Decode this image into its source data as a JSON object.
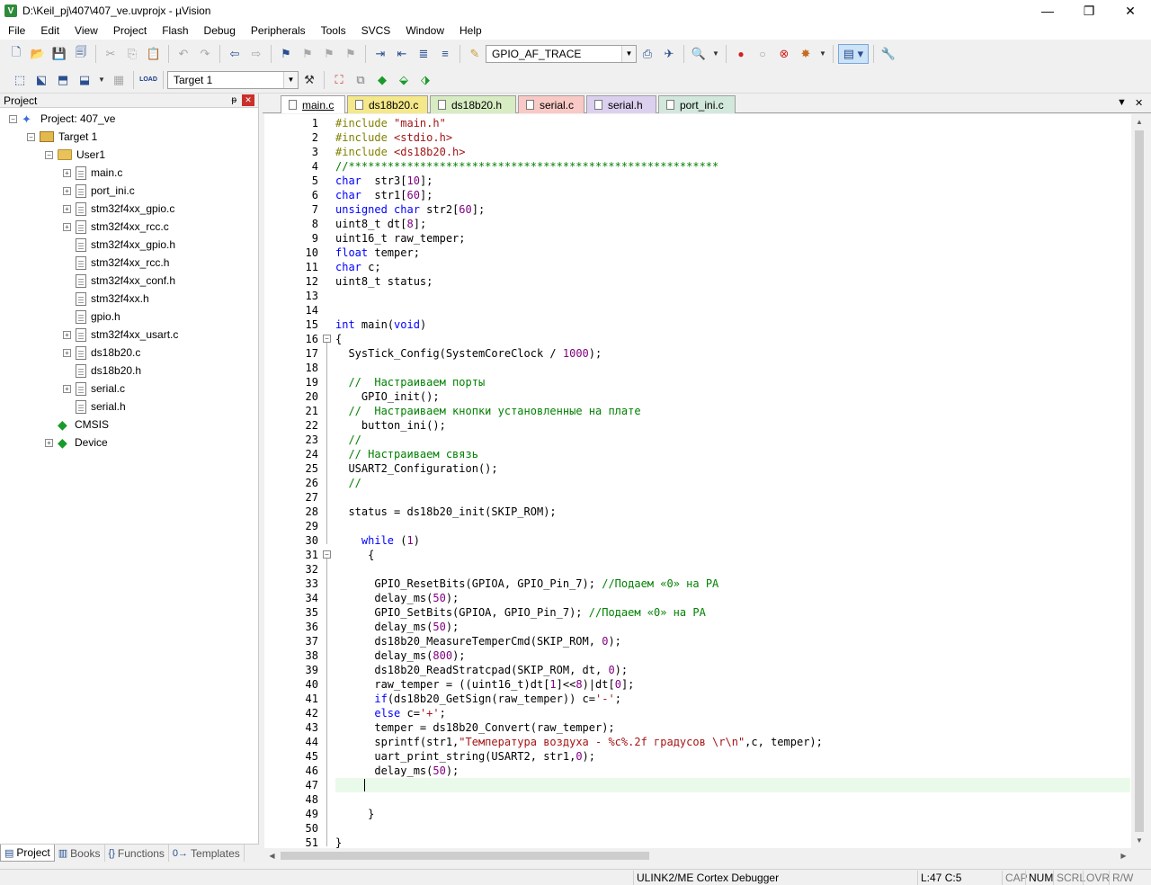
{
  "window": {
    "title": "D:\\Keil_pj\\407\\407_ve.uvprojx - µVision",
    "app_icon": "V",
    "controls": [
      "—",
      "❐",
      "✕"
    ]
  },
  "menu": [
    "File",
    "Edit",
    "View",
    "Project",
    "Flash",
    "Debug",
    "Peripherals",
    "Tools",
    "SVCS",
    "Window",
    "Help"
  ],
  "toolbar1": {
    "find_combo_value": "GPIO_AF_TRACE"
  },
  "toolbar2": {
    "target_combo_value": "Target 1",
    "load_label": "LOAD"
  },
  "project_panel": {
    "title": "Project",
    "pin": "ᵽ",
    "close": "✕",
    "tree": [
      {
        "label": "Project: 407_ve",
        "level": 0,
        "icon": "project",
        "expander": "−"
      },
      {
        "label": "Target 1",
        "level": 1,
        "icon": "target",
        "expander": "−"
      },
      {
        "label": "User1",
        "level": 2,
        "icon": "folder",
        "expander": "−"
      },
      {
        "label": "main.c",
        "level": 3,
        "icon": "file",
        "expander": "+"
      },
      {
        "label": "port_ini.c",
        "level": 3,
        "icon": "file",
        "expander": "+"
      },
      {
        "label": "stm32f4xx_gpio.c",
        "level": 3,
        "icon": "file",
        "expander": "+"
      },
      {
        "label": "stm32f4xx_rcc.c",
        "level": 3,
        "icon": "file",
        "expander": "+"
      },
      {
        "label": "stm32f4xx_gpio.h",
        "level": 3,
        "icon": "file",
        "expander": ""
      },
      {
        "label": "stm32f4xx_rcc.h",
        "level": 3,
        "icon": "file",
        "expander": ""
      },
      {
        "label": "stm32f4xx_conf.h",
        "level": 3,
        "icon": "file",
        "expander": ""
      },
      {
        "label": "stm32f4xx.h",
        "level": 3,
        "icon": "file",
        "expander": ""
      },
      {
        "label": "gpio.h",
        "level": 3,
        "icon": "file",
        "expander": ""
      },
      {
        "label": "stm32f4xx_usart.c",
        "level": 3,
        "icon": "file",
        "expander": "+"
      },
      {
        "label": "ds18b20.c",
        "level": 3,
        "icon": "file",
        "expander": "+"
      },
      {
        "label": "ds18b20.h",
        "level": 3,
        "icon": "file",
        "expander": ""
      },
      {
        "label": "serial.c",
        "level": 3,
        "icon": "file",
        "expander": "+"
      },
      {
        "label": "serial.h",
        "level": 3,
        "icon": "file",
        "expander": ""
      },
      {
        "label": "CMSIS",
        "level": 2,
        "icon": "gem",
        "expander": ""
      },
      {
        "label": "Device",
        "level": 2,
        "icon": "gem",
        "expander": "+"
      }
    ],
    "tabs": [
      {
        "label": "Project",
        "glyph": "▤",
        "active": true
      },
      {
        "label": "Books",
        "glyph": "▥",
        "active": false
      },
      {
        "label": "Functions",
        "glyph": "{}",
        "active": false
      },
      {
        "label": "Templates",
        "glyph": "0→",
        "active": false
      }
    ]
  },
  "editor_tabs": [
    {
      "label": "main.c",
      "color": "#ffffff",
      "active": true
    },
    {
      "label": "ds18b20.c",
      "color": "#f5e88a",
      "active": false
    },
    {
      "label": "ds18b20.h",
      "color": "#d7ecc2",
      "active": false
    },
    {
      "label": "serial.c",
      "color": "#f8c9c5",
      "active": false
    },
    {
      "label": "serial.h",
      "color": "#dcd0ef",
      "active": false
    },
    {
      "label": "port_ini.c",
      "color": "#d2e8dc",
      "active": false
    }
  ],
  "editor_tab_controls": {
    "dropdown": "▼",
    "close": "✕"
  },
  "code": {
    "current_line": 47,
    "lines": [
      [
        [
          "pp",
          "#include "
        ],
        [
          "st",
          "\"main.h\""
        ]
      ],
      [
        [
          "pp",
          "#include "
        ],
        [
          "st",
          "<stdio.h>"
        ]
      ],
      [
        [
          "pp",
          "#include "
        ],
        [
          "st",
          "<ds18b20.h>"
        ]
      ],
      [
        [
          "cm",
          "//*********************************************************"
        ]
      ],
      [
        [
          "kw",
          "char"
        ],
        [
          "",
          "  str3"
        ],
        [
          "",
          "["
        ],
        [
          "nu",
          "10"
        ],
        [
          "",
          "];"
        ]
      ],
      [
        [
          "kw",
          "char"
        ],
        [
          "",
          "  str1"
        ],
        [
          "",
          "["
        ],
        [
          "nu",
          "60"
        ],
        [
          "",
          "];"
        ]
      ],
      [
        [
          "kw",
          "unsigned"
        ],
        [
          "",
          " "
        ],
        [
          "kw",
          "char"
        ],
        [
          "",
          " str2"
        ],
        [
          "",
          "["
        ],
        [
          "nu",
          "60"
        ],
        [
          "",
          "];"
        ]
      ],
      [
        [
          "",
          "uint8_t dt"
        ],
        [
          "",
          "["
        ],
        [
          "nu",
          "8"
        ],
        [
          "",
          "];"
        ]
      ],
      [
        [
          "",
          "uint16_t raw_temper;"
        ]
      ],
      [
        [
          "kw",
          "float"
        ],
        [
          "",
          " temper;"
        ]
      ],
      [
        [
          "kw",
          "char"
        ],
        [
          "",
          " c;"
        ]
      ],
      [
        [
          "",
          "uint8_t status;"
        ]
      ],
      [],
      [],
      [
        [
          "kw",
          "int"
        ],
        [
          "",
          " main"
        ],
        [
          "",
          "("
        ],
        [
          "kw",
          "void"
        ],
        [
          "",
          ")"
        ]
      ],
      [
        [
          "",
          "{"
        ]
      ],
      [
        [
          "",
          "  SysTick_Config(SystemCoreClock / "
        ],
        [
          "nu",
          "1000"
        ],
        [
          "",
          ");"
        ]
      ],
      [],
      [
        [
          "",
          "  "
        ],
        [
          "cm",
          "//  Настраиваем порты"
        ]
      ],
      [
        [
          "",
          "    GPIO_init();"
        ]
      ],
      [
        [
          "",
          "  "
        ],
        [
          "cm",
          "//  Настраиваем кнопки установленные на плате"
        ]
      ],
      [
        [
          "",
          "    button_ini();"
        ]
      ],
      [
        [
          "",
          "  "
        ],
        [
          "cm",
          "//"
        ]
      ],
      [
        [
          "",
          "  "
        ],
        [
          "cm",
          "// Настраиваем связь"
        ]
      ],
      [
        [
          "",
          "  USART2_Configuration();"
        ]
      ],
      [
        [
          "",
          "  "
        ],
        [
          "cm",
          "//"
        ]
      ],
      [],
      [
        [
          "",
          "  status = ds18b20_init(SKIP_ROM);"
        ]
      ],
      [],
      [
        [
          "",
          "    "
        ],
        [
          "kw",
          "while"
        ],
        [
          "",
          " ("
        ],
        [
          "nu",
          "1"
        ],
        [
          "",
          ")"
        ]
      ],
      [
        [
          "",
          "     {"
        ]
      ],
      [],
      [
        [
          "",
          "      GPIO_ResetBits(GPIOA, GPIO_Pin_7); "
        ],
        [
          "cm",
          "//Подаем «0» на PA"
        ]
      ],
      [
        [
          "",
          "      delay_ms("
        ],
        [
          "nu",
          "50"
        ],
        [
          "",
          ");"
        ]
      ],
      [
        [
          "",
          "      GPIO_SetBits(GPIOA, GPIO_Pin_7); "
        ],
        [
          "cm",
          "//Подаем «0» на PA"
        ]
      ],
      [
        [
          "",
          "      delay_ms("
        ],
        [
          "nu",
          "50"
        ],
        [
          "",
          ");"
        ]
      ],
      [
        [
          "",
          "      ds18b20_MeasureTemperCmd(SKIP_ROM, "
        ],
        [
          "nu",
          "0"
        ],
        [
          "",
          ");"
        ]
      ],
      [
        [
          "",
          "      delay_ms("
        ],
        [
          "nu",
          "800"
        ],
        [
          "",
          ");"
        ]
      ],
      [
        [
          "",
          "      ds18b20_ReadStratcpad(SKIP_ROM, dt, "
        ],
        [
          "nu",
          "0"
        ],
        [
          "",
          ");"
        ]
      ],
      [
        [
          "",
          "      raw_temper = ((uint16_t)dt["
        ],
        [
          "nu",
          "1"
        ],
        [
          "",
          "]<<"
        ],
        [
          "nu",
          "8"
        ],
        [
          "",
          ")|dt["
        ],
        [
          "nu",
          "0"
        ],
        [
          "",
          "];"
        ]
      ],
      [
        [
          "",
          "      "
        ],
        [
          "kw",
          "if"
        ],
        [
          "",
          "(ds18b20_GetSign(raw_temper)) c="
        ],
        [
          "st",
          "'-'"
        ],
        [
          "",
          ";"
        ]
      ],
      [
        [
          "",
          "      "
        ],
        [
          "kw",
          "else"
        ],
        [
          "",
          " c="
        ],
        [
          "st",
          "'+'"
        ],
        [
          "",
          ";"
        ]
      ],
      [
        [
          "",
          "      temper = ds18b20_Convert(raw_temper);"
        ]
      ],
      [
        [
          "",
          "      sprintf(str1,"
        ],
        [
          "st",
          "\"Температура воздуха - %c%.2f градусов \\r\\n\""
        ],
        [
          "",
          ",c, temper);"
        ]
      ],
      [
        [
          "",
          "      uart_print_string(USART2, str1,"
        ],
        [
          "nu",
          "0"
        ],
        [
          "",
          ");"
        ]
      ],
      [
        [
          "",
          "      delay_ms("
        ],
        [
          "nu",
          "50"
        ],
        [
          "",
          ");"
        ]
      ],
      [],
      [],
      [
        [
          "",
          "     }"
        ]
      ],
      [],
      [
        [
          "",
          "}"
        ]
      ]
    ]
  },
  "folds": [
    {
      "line": 16,
      "glyph": "−"
    },
    {
      "line": 31,
      "glyph": "−"
    }
  ],
  "status_bar": {
    "debugger": "ULINK2/ME Cortex Debugger",
    "position": "L:47 C:5",
    "cap": "CAP",
    "num": "NUM",
    "scrl": "SCRL",
    "ovr": "OVR",
    "rw": "R/W"
  },
  "icons": {
    "new": "new-file-icon",
    "open": "open-folder-icon",
    "save": "save-icon",
    "save_all": "save-all-icon",
    "cut": "cut-icon",
    "copy": "copy-icon",
    "paste": "paste-icon",
    "undo": "undo-icon",
    "redo": "redo-icon",
    "back": "nav-back-icon",
    "forward": "nav-forward-icon",
    "bookmark": "bookmark-icon",
    "indent": "indent-icon",
    "outdent": "outdent-icon",
    "comment": "comment-icon",
    "uncomment": "uncomment-icon",
    "find_files": "find-in-files-icon",
    "debug": "start-debug-icon",
    "breakpoint": "breakpoint-icon",
    "window_layout": "window-layout-icon",
    "config": "wrench-icon",
    "translate": "translate-icon",
    "build": "build-icon",
    "rebuild": "rebuild-icon",
    "batch": "batch-build-icon",
    "stop_build": "stop-build-icon",
    "download": "load-icon",
    "target_options": "target-options-icon",
    "manage_components": "manage-components-icon"
  }
}
